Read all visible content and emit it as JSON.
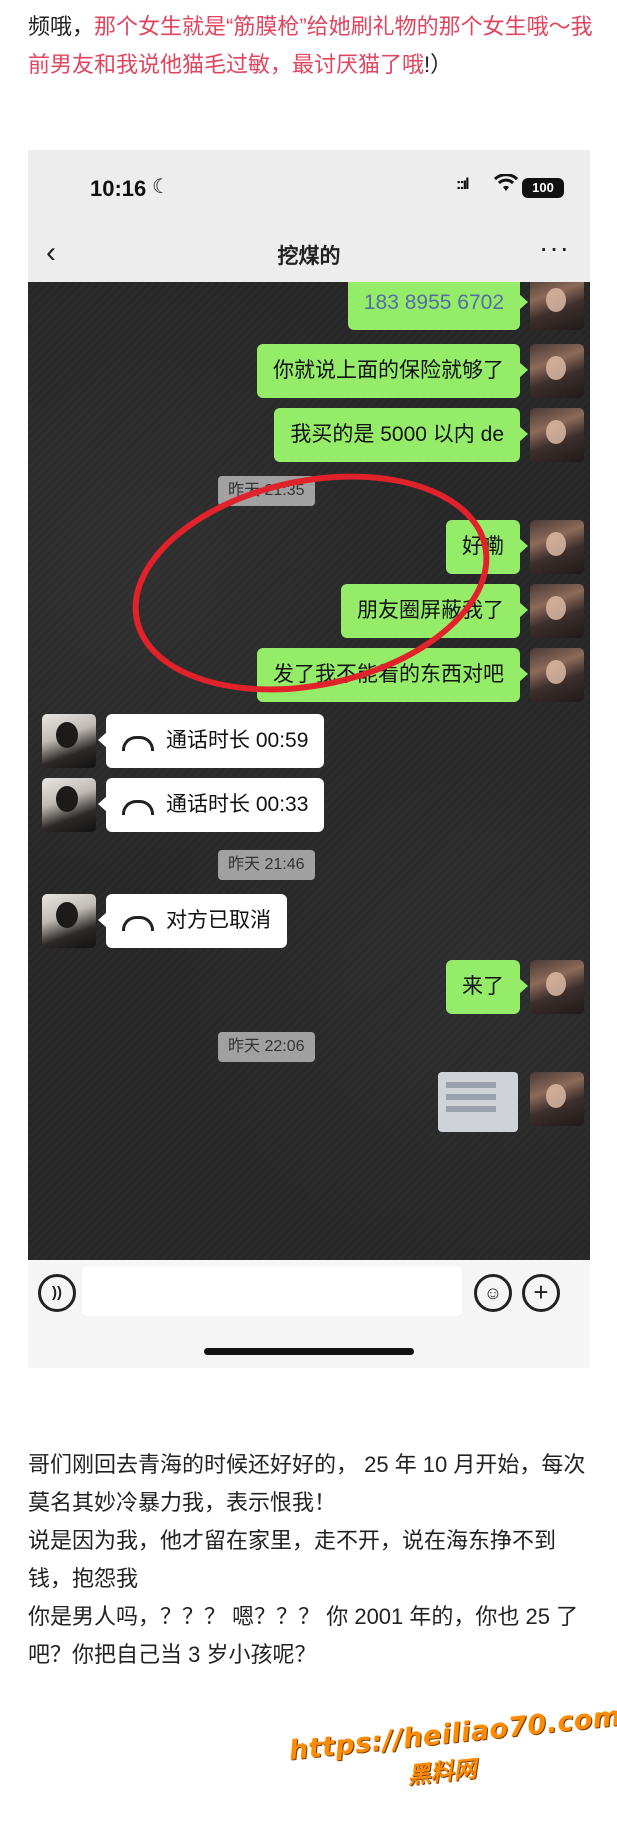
{
  "intro": {
    "part1": "频哦，",
    "highlight": "那个女生就是“筋膜枪”给她刷礼物的那个女生哦～我前男友和我说他猫毛过敏，最讨厌猫了哦",
    "part3": "!）"
  },
  "phone": {
    "status": {
      "time": "10:16",
      "moon_icon": "☾",
      "signal_icon": "::ıl",
      "wifi_icon": "wifi",
      "battery": "100"
    },
    "nav": {
      "back_icon": "‹",
      "title": "挖煤的",
      "more_icon": "···"
    },
    "messages": [
      {
        "side": "right",
        "text": "183 8955 6702"
      },
      {
        "side": "right",
        "text": "你就说上面的保险就够了"
      },
      {
        "side": "right",
        "text": "我买的是 5000 以内 de"
      },
      {
        "type": "timestamp",
        "text": "昨天 21:35"
      },
      {
        "side": "right",
        "text": "好嘞"
      },
      {
        "side": "right",
        "text": "朋友圈屏蔽我了"
      },
      {
        "side": "right",
        "text": "发了我不能看的东西对吧"
      },
      {
        "side": "left",
        "type": "call",
        "text": "通话时长 00:59"
      },
      {
        "side": "left",
        "type": "call",
        "text": "通话时长 00:33"
      },
      {
        "type": "timestamp",
        "text": "昨天 21:46"
      },
      {
        "side": "left",
        "type": "call",
        "text": "对方已取消"
      },
      {
        "side": "right",
        "text": "来了"
      },
      {
        "type": "timestamp",
        "text": "昨天 22:06"
      }
    ],
    "input": {
      "placeholder": "",
      "voice_icon": "voice",
      "emoji_icon": "emoji",
      "plus_icon": "+"
    },
    "annotation_color": "#e2222a"
  },
  "body_text": [
    "哥们刚回去青海的时候还好好的， 25 年 10 月开始，每次莫名其妙冷暴力我，表示恨我！",
    "说是因为我，他才留在家里，走不开，说在海东挣不到钱，抱怨我",
    "你是男人吗，？？？ 嗯？？？ 你 2001 年的，你也 25 了吧？你把自己当 3 岁小孩呢？"
  ],
  "watermark": {
    "url": "https://heiliao70.com",
    "name": "黑料网"
  },
  "colors": {
    "accent_pink": "#e0445f",
    "bubble_green": "#95ec69",
    "link_blue": "#546fa6",
    "watermark_orange": "#ff8c00"
  }
}
